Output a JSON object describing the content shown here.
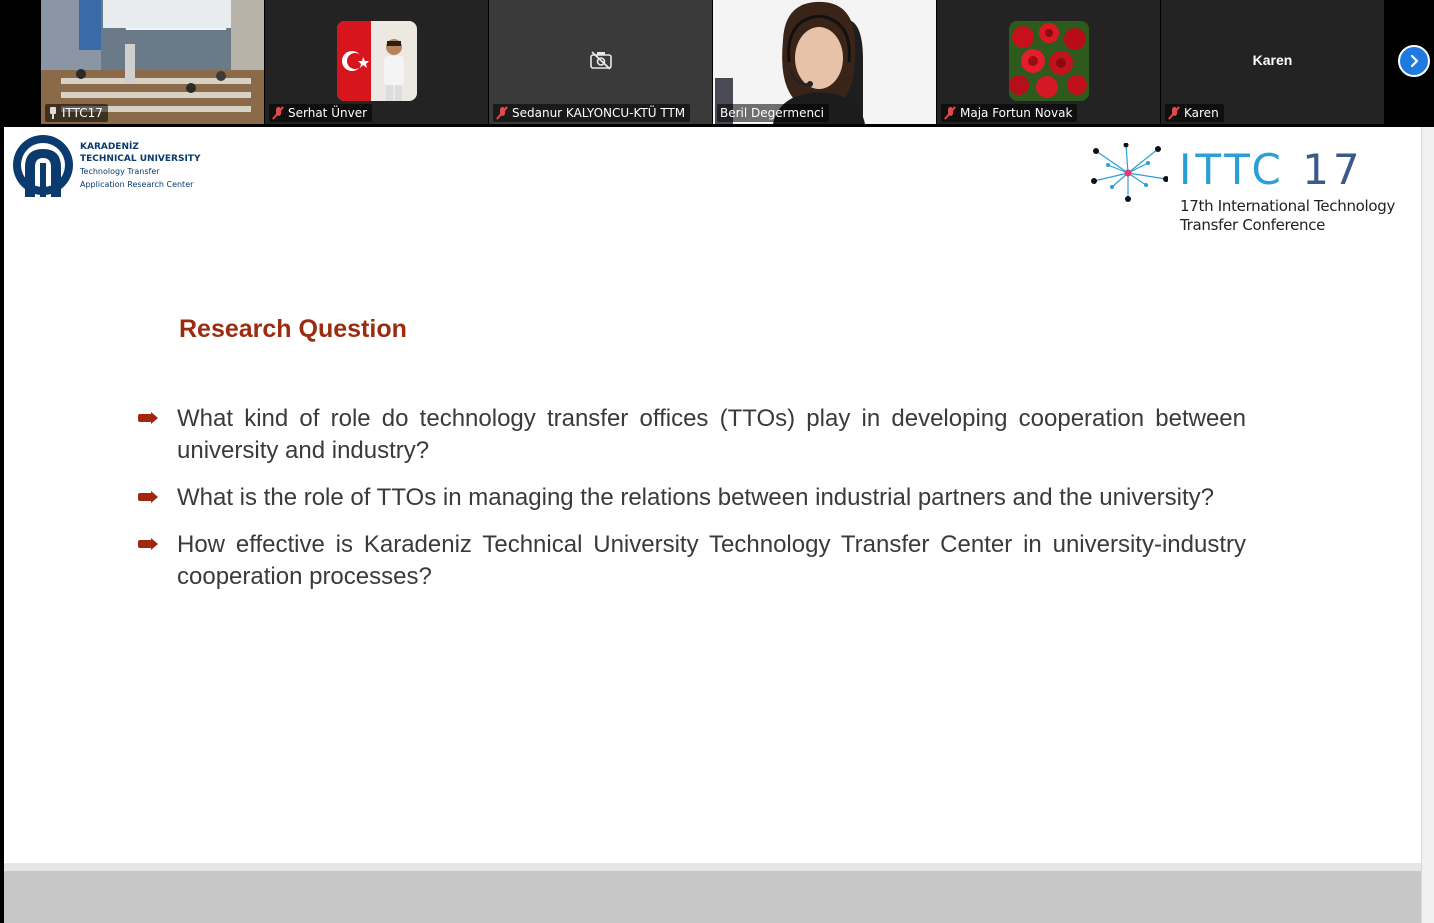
{
  "participants": [
    {
      "name": "ITTC17",
      "pinned": true,
      "muted": false,
      "video": "room"
    },
    {
      "name": "Serhat Ünver",
      "pinned": false,
      "muted": true,
      "video": "avatar-flag"
    },
    {
      "name": "Sedanur KALYONCU-KTÜ TTM",
      "pinned": false,
      "muted": true,
      "video": "camera-off"
    },
    {
      "name": "Beril Degermenci",
      "pinned": false,
      "muted": false,
      "video": "webcam",
      "speaking": true
    },
    {
      "name": "Maja Fortun Novak",
      "pinned": false,
      "muted": true,
      "video": "avatar-roses"
    },
    {
      "name": "Karen",
      "pinned": false,
      "muted": true,
      "video": "name-only",
      "display_name": "Karen"
    }
  ],
  "icons": {
    "next": "chevron-right-icon",
    "mute": "mic-off-icon",
    "pin": "pin-icon",
    "camera_off": "camera-off-icon"
  },
  "slide": {
    "university": {
      "line1": "KARADENİZ",
      "line2": "TECHNICAL UNIVERSITY",
      "line3": "Technology Transfer",
      "line4": "Application Research Center"
    },
    "conference": {
      "title_letters": "ITTC",
      "title_number": "17",
      "subtitle_line1": "17th International Technology",
      "subtitle_line2": "Transfer Conference"
    },
    "heading": "Research Question",
    "bullets": [
      "What kind of role do technology transfer offices (TTOs) play in developing cooperation between university and industry?",
      "What is the role of TTOs in managing the relations between industrial partners and the university?",
      "How effective is Karadeniz Technical University Technology Transfer Center in university-industry cooperation processes?"
    ]
  },
  "colors": {
    "accent_red": "#9b2c10",
    "ktu_blue": "#0a3a6e",
    "ittc_cyan": "#2a9fd6",
    "speaking_outline": "#22c55e",
    "next_button": "#1f7ae0",
    "muted_red": "#e5484d"
  }
}
